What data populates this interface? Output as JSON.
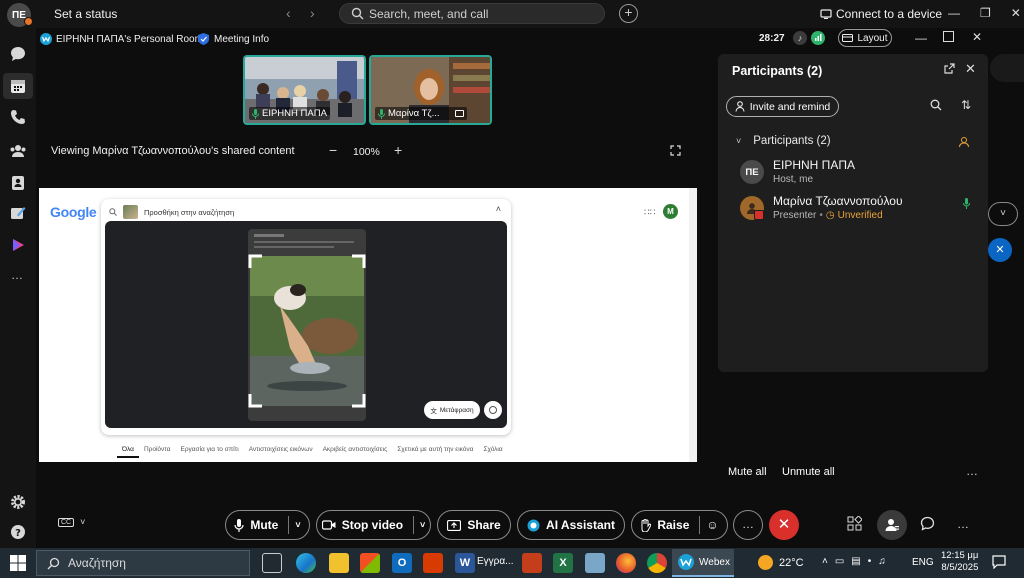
{
  "topbar": {
    "avatar_initials": "ΠΕ",
    "set_status": "Set a status",
    "search_placeholder": "Search, meet, and call",
    "connect_device": "Connect to a device"
  },
  "meeting": {
    "room_name": "ΕΙΡΗΝΗ ΠΑΠΑ's Personal Room",
    "meeting_info": "Meeting Info",
    "timer": "28:27",
    "layout_label": "Layout"
  },
  "tiles": [
    {
      "name": "ΕΙΡΗΝΗ ΠΑΠΑ"
    },
    {
      "name": "Μαρίνα Τζ..."
    }
  ],
  "share": {
    "viewing_text": "Viewing Μαρίνα Τζωαννοπούλου's shared content",
    "zoom": "100%"
  },
  "google": {
    "logo": "Google",
    "search_placeholder": "Προσθήκη στην αναζήτηση",
    "translate": "Μετάφραση",
    "avatar": "M",
    "tabs": [
      "Όλα",
      "Προϊόντα",
      "Εργασία για το σπίτι",
      "Αντιστοιχίσεις εικόνων",
      "Ακριβείς αντιστοιχίσεις",
      "Σχετικά με αυτή την εικόνα",
      "Σχόλια"
    ]
  },
  "panel": {
    "title": "Participants (2)",
    "invite": "Invite and remind",
    "group_label": "Participants (2)",
    "participants": [
      {
        "initials": "ΠΕ",
        "name": "ΕΙΡΗΝΗ ΠΑΠΑ",
        "role": "Host, me",
        "avatar_color": "#4a4a4a"
      },
      {
        "initials": "",
        "name": "Μαρίνα Τζωαννοπούλου",
        "role": "Presenter",
        "status": "Unverified",
        "avatar_color": "#a0672a"
      }
    ],
    "mute_all": "Mute all",
    "unmute_all": "Unmute all"
  },
  "controls": {
    "mute": "Mute",
    "stop_video": "Stop video",
    "share": "Share",
    "ai_assistant": "AI Assistant",
    "raise": "Raise"
  },
  "taskbar": {
    "search": "Αναζήτηση",
    "word_label": "Εγγρα...",
    "webex_label": "Webex",
    "temperature": "22°C",
    "language": "ENG",
    "time": "12:15 μμ",
    "date": "8/5/2025"
  },
  "colors": {
    "accent_teal": "#28a897",
    "end_red": "#d9302c",
    "unverified": "#e9a23b",
    "mic_green": "#2fb36a"
  }
}
